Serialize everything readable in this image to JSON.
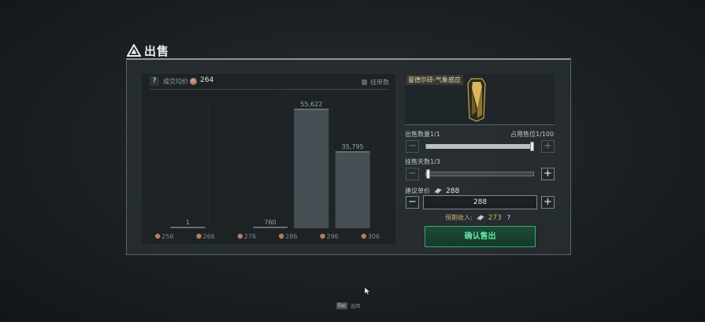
{
  "title": "出售",
  "chart_header": {
    "help": "?",
    "avg_label": "成交均价",
    "avg_value": "264",
    "toggle_label": "挂单数"
  },
  "chart_data": {
    "type": "bar",
    "categories": [
      "256",
      "266",
      "276",
      "286",
      "296",
      "306"
    ],
    "x_ticks": [
      "256",
      "266",
      "276",
      "286",
      "296",
      "306"
    ],
    "bars": [
      {
        "x": 261,
        "value": 1
      },
      {
        "x": 281,
        "value": 760
      },
      {
        "x": 291,
        "value": 55622
      },
      {
        "x": 301,
        "value": 35795
      }
    ],
    "value_labels": [
      "1",
      "760",
      "55,622",
      "35,795"
    ],
    "ylim": [
      0,
      60000
    ],
    "xlim": [
      251,
      311
    ],
    "grid": false
  },
  "item": {
    "name": "曼德尔砖-气象感应"
  },
  "quantity": {
    "label": "出售数量1/1",
    "slots_label": "占用售位1/100",
    "minus": "−",
    "plus": "+",
    "fraction": 1.0
  },
  "days": {
    "label": "挂售天数1/3",
    "minus": "−",
    "plus": "+",
    "fraction": 0.0
  },
  "price": {
    "label": "建议单价",
    "suggested": "288",
    "value": "288",
    "minus": "−",
    "plus": "+"
  },
  "income": {
    "label": "预期收入:",
    "value": "273",
    "help": "?"
  },
  "confirm_label": "确认售出",
  "footer": {
    "key": "Esc",
    "label": "返回"
  },
  "colors": {
    "accent": "#2fae73",
    "gold": "#c9b06a"
  }
}
